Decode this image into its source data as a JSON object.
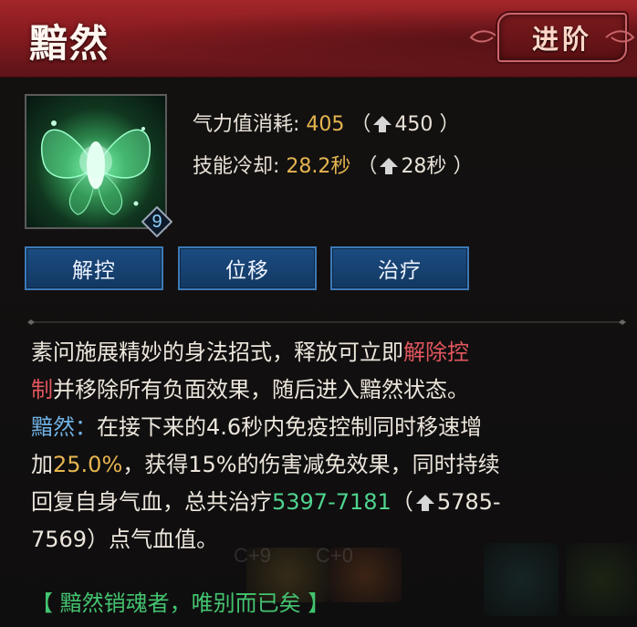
{
  "header": {
    "title": "黯然",
    "advance_label": "进阶"
  },
  "skill": {
    "level": "9",
    "icon": "butterfly-skill-icon",
    "tags": [
      "解控",
      "位移",
      "治疗"
    ],
    "stats": [
      {
        "label": "气力值消耗:",
        "value": "405",
        "paren_open": "（",
        "upgrade_value": "450",
        "paren_close": "）"
      },
      {
        "label": "技能冷却:",
        "value": "28.2秒",
        "paren_open": "（",
        "upgrade_value": "28秒",
        "paren_close": "）"
      }
    ]
  },
  "description": {
    "line1_a": "素问施展精妙的身法招式，释放可立即",
    "line1_b": "解除控",
    "line2_a": "制",
    "line2_b": "并移除所有负面效果，随后进入黯然状态。",
    "line3_a": "黯然：",
    "line3_b": "在接下来的4.6秒内免疫控制同时移速增",
    "line4_a": "加",
    "line4_b": "25.0%",
    "line4_c": "，获得15%的伤害减免效果，同时持续",
    "line5_a": "回复自身气血，总共治疗",
    "line5_b": "5397-7181",
    "line5_c": "（",
    "line5_d": "5785-",
    "line6_a": "7569",
    "line6_b": "）点气血值。"
  },
  "footer": {
    "quote": "【 黯然销魂者，唯别而已矣 】"
  },
  "background": {
    "ghost_labels": [
      "C+9",
      "C+0"
    ]
  },
  "colors": {
    "header_red": "#a3262a",
    "value_gold": "#e6b550",
    "highlight_red": "#e2565e",
    "keyword_blue": "#6fb2e6",
    "heal_green": "#4fd38e",
    "tag_blue": "#1c4c82"
  }
}
